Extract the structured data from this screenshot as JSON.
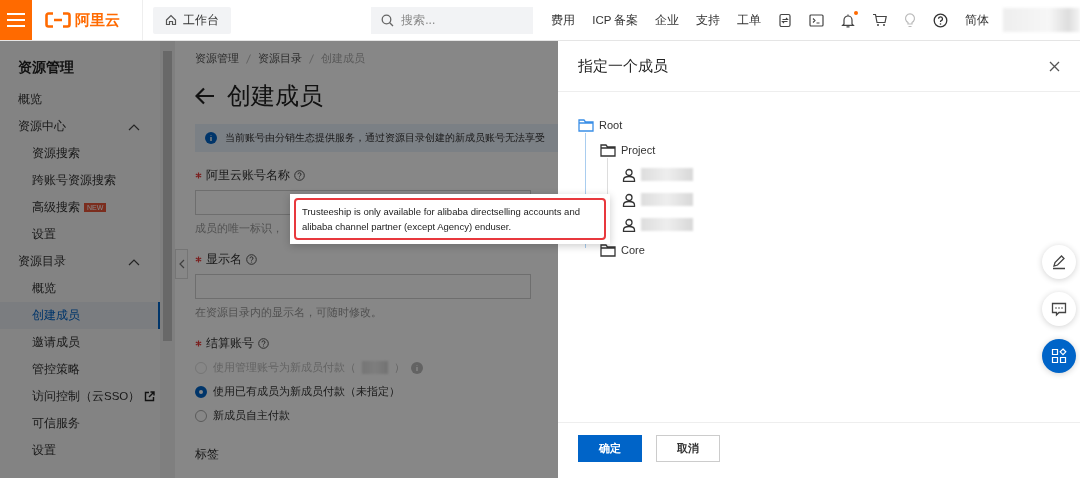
{
  "top_bar": {
    "brand": "阿里云",
    "workbench": "工作台",
    "search": {
      "placeholder": "搜索..."
    },
    "links": [
      "费用",
      "ICP 备案",
      "企业",
      "支持",
      "工单"
    ],
    "notifications_unread": true,
    "language": "简体",
    "account": {
      "redacted": true
    }
  },
  "sidebar": {
    "title": "资源管理",
    "items": [
      {
        "kind": "link",
        "label": "概览",
        "selected": false
      },
      {
        "kind": "group",
        "label": "资源中心",
        "expanded": true,
        "children": [
          {
            "label": "资源搜索",
            "selected": false
          },
          {
            "label": "跨账号资源搜索",
            "selected": false
          },
          {
            "label": "高级搜索",
            "badge": "NEW",
            "selected": false
          },
          {
            "label": "设置",
            "selected": false
          }
        ]
      },
      {
        "kind": "group",
        "label": "资源目录",
        "expanded": true,
        "children": [
          {
            "label": "概览",
            "selected": false
          },
          {
            "label": "创建成员",
            "selected": true
          },
          {
            "label": "邀请成员",
            "selected": false
          },
          {
            "label": "管控策略",
            "selected": false
          },
          {
            "label": "访问控制（云SSO）",
            "external": true,
            "selected": false
          },
          {
            "label": "可信服务",
            "selected": false
          },
          {
            "label": "设置",
            "selected": false
          }
        ]
      }
    ]
  },
  "breadcrumb": [
    "资源管理",
    "资源目录",
    "创建成员"
  ],
  "page_title": "创建成员",
  "notice": "当前账号由分销生态提供服务，通过资源目录创建的新成员账号无法享受",
  "form": {
    "fields": [
      {
        "label": "阿里云账号名称",
        "required": true,
        "hint": "成员的唯一标识，"
      },
      {
        "label": "显示名",
        "required": true,
        "hint": "在资源目录内的显示名，可随时修改。"
      }
    ],
    "billing": {
      "label": "结算账号",
      "required": true,
      "options": [
        {
          "label": "使用管理账号为新成员付款（",
          "label_end": "）",
          "redacted": true,
          "info": true,
          "disabled": true,
          "selected": false
        },
        {
          "label": "使用已有成员为新成员付款（未指定）",
          "disabled": false,
          "selected": true
        },
        {
          "label": "新成员自主付款",
          "disabled": false,
          "selected": false
        }
      ]
    },
    "tags_label": "标签"
  },
  "tooltip": {
    "text": "Trusteeship is only available for alibaba directselling accounts and alibaba channel partner (except Agency) enduser.",
    "highlighted": true
  },
  "drawer": {
    "title": "指定一个成员",
    "tree": [
      {
        "kind": "folder",
        "label": "Root",
        "selected": true,
        "children": [
          {
            "kind": "folder",
            "label": "Project",
            "selected": false,
            "children": [
              {
                "kind": "user",
                "redacted": true,
                "selected": false
              },
              {
                "kind": "user",
                "redacted": true,
                "selected": false
              },
              {
                "kind": "user",
                "redacted": true,
                "selected": false
              }
            ]
          },
          {
            "kind": "folder",
            "label": "Core",
            "selected": false
          }
        ]
      }
    ],
    "buttons": [
      {
        "label": "确定",
        "kind": "primary"
      },
      {
        "label": "取消",
        "kind": "secondary"
      }
    ]
  }
}
